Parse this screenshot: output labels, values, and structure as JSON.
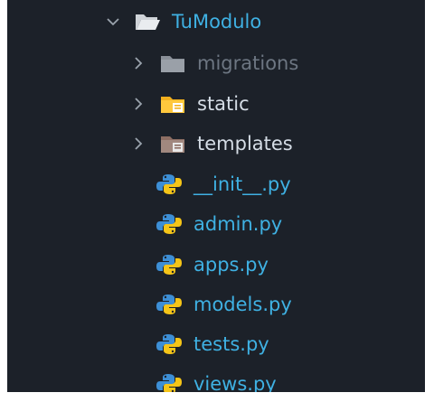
{
  "explorer": {
    "root": {
      "label": "TuModulo",
      "icon": "folder-open-icon",
      "expanded": true
    },
    "folders": [
      {
        "label": "migrations",
        "icon": "folder-icon",
        "dimmed": true
      },
      {
        "label": "static",
        "icon": "folder-static-icon",
        "dimmed": false
      },
      {
        "label": "templates",
        "icon": "folder-templates-icon",
        "dimmed": false
      }
    ],
    "files": [
      {
        "label": "__init__.py",
        "icon": "python-icon"
      },
      {
        "label": "admin.py",
        "icon": "python-icon"
      },
      {
        "label": "apps.py",
        "icon": "python-icon"
      },
      {
        "label": "models.py",
        "icon": "python-icon"
      },
      {
        "label": "tests.py",
        "icon": "python-icon"
      },
      {
        "label": "views.py",
        "icon": "python-icon"
      }
    ]
  },
  "colors": {
    "background": "#1c2129",
    "file_text": "#3fb1e3",
    "folder_text": "#d5dde6",
    "dimmed_text": "#6d7682"
  }
}
